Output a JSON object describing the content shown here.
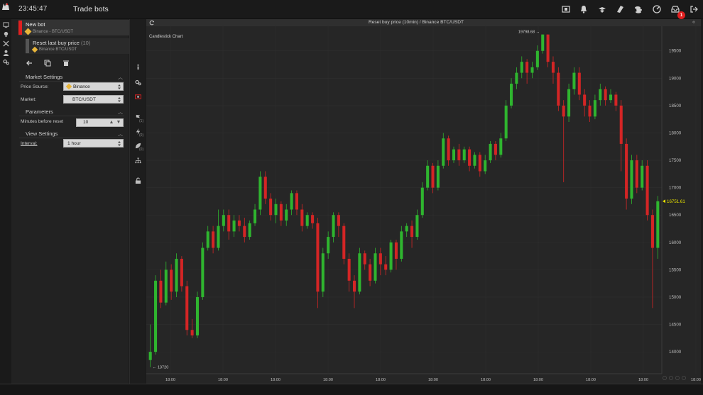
{
  "header": {
    "time": "23:45:47",
    "title": "Trade bots",
    "notification_count": "1",
    "icons": [
      "screenshot-icon",
      "bell-icon",
      "signal-icon",
      "tag-icon",
      "coins-icon",
      "gauge-icon",
      "inbox-icon",
      "logout-icon"
    ]
  },
  "left_rail": {
    "icons": [
      "monitor-icon",
      "bulb-icon",
      "tools-icon",
      "user-icon",
      "settings-icon"
    ]
  },
  "bots": [
    {
      "name": "New bot",
      "source": "Binance - BTC/USDT",
      "active": true
    },
    {
      "name": "Reset last buy price",
      "count": "(10)",
      "source": "Binance BTC/USDT",
      "active": false
    }
  ],
  "toolbar": {
    "back": "back-icon",
    "copy": "copy-icon",
    "delete": "trash-icon"
  },
  "market_settings": {
    "title": "Market Settings",
    "price_source_label": "Price Source:",
    "price_source_value": "Binance",
    "market_label": "Market:",
    "market_value": "BTC/USDT"
  },
  "parameters": {
    "title": "Parameters",
    "minutes_label": "Minutes before reset",
    "minutes_value": "10"
  },
  "view_settings": {
    "title": "View Settings",
    "interval_label": "Interval:",
    "interval_value": "1 hour"
  },
  "mid_rail": {
    "icons": [
      "info-icon",
      "config-icon",
      "money-icon",
      "flag-icon",
      "bolt-icon",
      "leaf-icon",
      "hierarchy-icon",
      "unlock-icon"
    ],
    "counts": [
      "(1)",
      "(0)",
      "(0)"
    ]
  },
  "chart": {
    "header_title": "Reset buy price (10min) / Binance BTC/USDT",
    "type_label": "Candlestick Chart"
  },
  "colors": {
    "up": "#2fb52f",
    "down": "#d42525",
    "panel": "#262626",
    "accent_red": "#e02020",
    "price_tag": "#e8e200"
  },
  "chart_data": {
    "type": "candlestick",
    "y_ticks": [
      14000,
      14500,
      15000,
      15500,
      16000,
      16500,
      17000,
      17500,
      18000,
      18500,
      19000,
      19500
    ],
    "x_ticks": [
      "18:00",
      "18:00",
      "18:00",
      "18:00",
      "18:00",
      "18:00",
      "18:00",
      "18:00",
      "18:00",
      "18:00",
      "18:00"
    ],
    "ylim": [
      13600,
      19950
    ],
    "high_label": "19798.68",
    "low_label": "13720",
    "last_price": "16751.61",
    "last_price_value": 16751.61,
    "candles": [
      [
        13850,
        14000,
        13720,
        14500
      ],
      [
        14000,
        15300,
        13950,
        15400
      ],
      [
        15300,
        14900,
        14800,
        15500
      ],
      [
        14900,
        15500,
        14850,
        15650
      ],
      [
        15500,
        15100,
        14950,
        15600
      ],
      [
        15100,
        15700,
        15000,
        15800
      ],
      [
        15700,
        15200,
        15100,
        15750
      ],
      [
        15200,
        14400,
        14300,
        15300
      ],
      [
        14400,
        14300,
        14250,
        14600
      ],
      [
        14300,
        15000,
        14250,
        15100
      ],
      [
        15000,
        15900,
        14950,
        16000
      ],
      [
        15900,
        16200,
        15850,
        16300
      ],
      [
        16200,
        15900,
        15800,
        16300
      ],
      [
        15900,
        16300,
        15850,
        16600
      ],
      [
        16300,
        16500,
        16200,
        16600
      ],
      [
        16500,
        16200,
        16050,
        16600
      ],
      [
        16200,
        16400,
        16100,
        16500
      ],
      [
        16400,
        16300,
        16200,
        16500
      ],
      [
        16300,
        16100,
        16000,
        16450
      ],
      [
        16100,
        16350,
        16050,
        16400
      ],
      [
        16350,
        16600,
        16300,
        16700
      ],
      [
        16600,
        17200,
        16500,
        17300
      ],
      [
        17200,
        16800,
        16700,
        17300
      ],
      [
        16800,
        16500,
        16400,
        16900
      ],
      [
        16500,
        16700,
        16350,
        16800
      ],
      [
        16700,
        16400,
        16300,
        16750
      ],
      [
        16400,
        16600,
        16300,
        16700
      ],
      [
        16600,
        16900,
        16500,
        16950
      ],
      [
        16900,
        16600,
        16500,
        16950
      ],
      [
        16600,
        16300,
        16200,
        16700
      ],
      [
        16300,
        16500,
        16250,
        16550
      ],
      [
        16500,
        16350,
        16250,
        16550
      ],
      [
        16350,
        15100,
        14800,
        16450
      ],
      [
        15100,
        15800,
        15000,
        15900
      ],
      [
        15800,
        16100,
        15700,
        16200
      ],
      [
        16100,
        16500,
        16000,
        16550
      ],
      [
        16500,
        16300,
        16100,
        16550
      ],
      [
        16300,
        15700,
        15600,
        16350
      ],
      [
        15700,
        15300,
        15100,
        15800
      ],
      [
        15300,
        15100,
        14800,
        15400
      ],
      [
        15100,
        15800,
        15050,
        15900
      ],
      [
        15800,
        15600,
        15500,
        15850
      ],
      [
        15600,
        15300,
        15200,
        15700
      ],
      [
        15300,
        15800,
        15250,
        15900
      ],
      [
        15800,
        15600,
        15400,
        15900
      ],
      [
        15600,
        15500,
        15400,
        15750
      ],
      [
        15500,
        16000,
        15450,
        16050
      ],
      [
        16000,
        15700,
        15500,
        16050
      ],
      [
        15700,
        16200,
        15650,
        16300
      ],
      [
        16200,
        16300,
        16100,
        16350
      ],
      [
        16300,
        16100,
        15900,
        16400
      ],
      [
        16100,
        16500,
        16050,
        16600
      ],
      [
        16500,
        17000,
        16450,
        17100
      ],
      [
        17000,
        17400,
        16950,
        17500
      ],
      [
        17400,
        17000,
        16900,
        17450
      ],
      [
        17000,
        17400,
        16950,
        17500
      ],
      [
        17400,
        17900,
        17350,
        18000
      ],
      [
        17900,
        17500,
        17400,
        17950
      ],
      [
        17500,
        17700,
        17450,
        17750
      ],
      [
        17700,
        17500,
        17400,
        17800
      ],
      [
        17500,
        17700,
        17450,
        17750
      ],
      [
        17700,
        17400,
        17300,
        17750
      ],
      [
        17400,
        17600,
        17350,
        17650
      ],
      [
        17600,
        17300,
        17200,
        17650
      ],
      [
        17300,
        17500,
        17250,
        17600
      ],
      [
        17500,
        17800,
        17450,
        17850
      ],
      [
        17800,
        17600,
        17500,
        17850
      ],
      [
        17600,
        17900,
        17550,
        18000
      ],
      [
        17900,
        18500,
        17850,
        18600
      ],
      [
        18500,
        18900,
        18450,
        19000
      ],
      [
        18900,
        19100,
        18800,
        19200
      ],
      [
        19100,
        19300,
        19000,
        19400
      ],
      [
        19300,
        19100,
        18900,
        19350
      ],
      [
        19100,
        19200,
        19000,
        19300
      ],
      [
        19200,
        19500,
        19150,
        19600
      ],
      [
        19500,
        19799,
        19450,
        19799
      ],
      [
        19799,
        19300,
        19200,
        19799
      ],
      [
        19300,
        19100,
        18900,
        19400
      ],
      [
        19100,
        18500,
        18400,
        19200
      ],
      [
        18500,
        18300,
        17100,
        18600
      ],
      [
        18300,
        18800,
        18200,
        18900
      ],
      [
        18800,
        19100,
        18700,
        19200
      ],
      [
        19100,
        18700,
        18600,
        19200
      ],
      [
        18700,
        18500,
        18300,
        18800
      ],
      [
        18500,
        18300,
        18200,
        18600
      ],
      [
        18300,
        18600,
        18250,
        18700
      ],
      [
        18600,
        18800,
        18500,
        18900
      ],
      [
        18800,
        18600,
        18500,
        18850
      ],
      [
        18600,
        18700,
        18550,
        18800
      ],
      [
        18700,
        18500,
        18400,
        18750
      ],
      [
        18500,
        17800,
        17300,
        18600
      ],
      [
        17800,
        16800,
        16600,
        17900
      ],
      [
        16800,
        17500,
        16700,
        17600
      ],
      [
        17500,
        17000,
        16900,
        17600
      ],
      [
        17000,
        17400,
        16950,
        17500
      ],
      [
        17400,
        16500,
        16400,
        17500
      ],
      [
        16500,
        15900,
        14800,
        16600
      ],
      [
        15900,
        16751.61,
        15700,
        16850
      ]
    ]
  }
}
